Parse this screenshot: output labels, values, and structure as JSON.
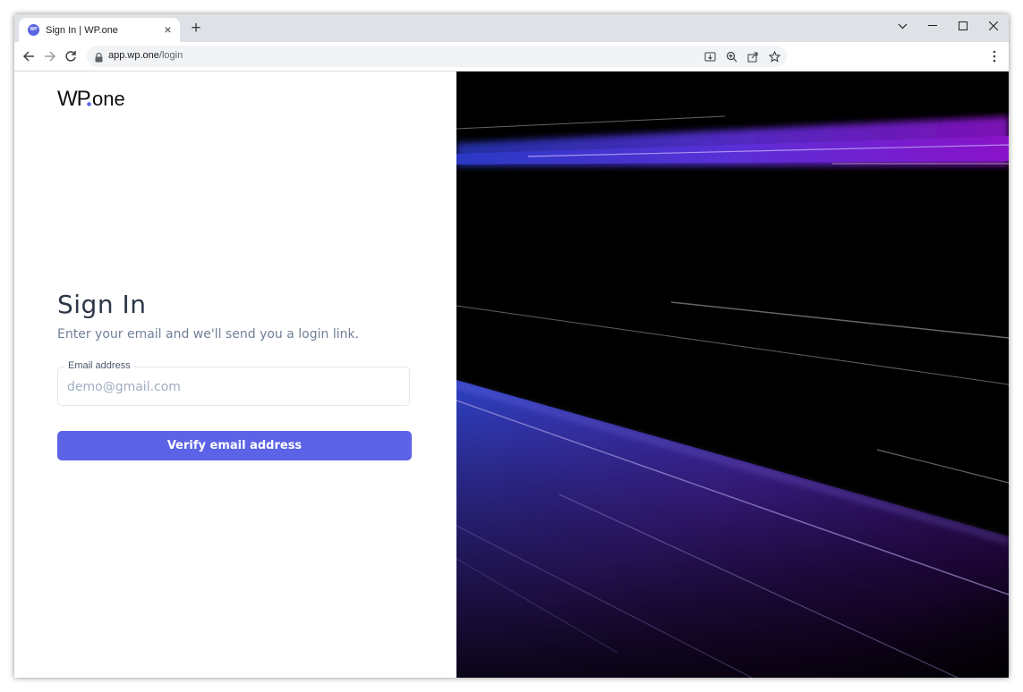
{
  "browser": {
    "tab_title": "Sign In | WP.one",
    "favicon_text": "WP",
    "url_host": "app.wp.one",
    "url_path": "/login"
  },
  "icons": {
    "back": "arrow-left-icon",
    "forward": "arrow-right-icon",
    "reload": "reload-icon",
    "lock": "lock-icon",
    "install": "install-app-icon",
    "zoom": "zoom-icon",
    "share": "share-icon",
    "bookmark": "star-icon",
    "menu": "kebab-menu-icon"
  },
  "login": {
    "logo_text_wp": "WP",
    "logo_text_one": "one",
    "title": "Sign In",
    "subtitle": "Enter your email and we'll send you a login link.",
    "email_label": "Email address",
    "email_placeholder": "demo@gmail.com",
    "email_value": "",
    "verify_label": "Verify email address"
  },
  "colors": {
    "accent": "#5c63e6",
    "logo_dot": "#5c63e6",
    "hero_purple": "#7a1fd0",
    "hero_blue": "#3848c8"
  }
}
